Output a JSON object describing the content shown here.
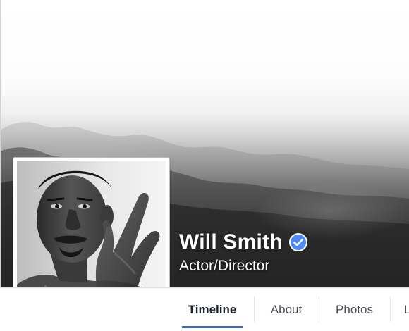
{
  "profile": {
    "name": "Will Smith",
    "subtitle": "Actor/Director",
    "verified": true
  },
  "nav": {
    "tabs": [
      {
        "label": "Timeline",
        "active": true
      },
      {
        "label": "About",
        "active": false
      },
      {
        "label": "Photos",
        "active": false
      },
      {
        "label": "L",
        "active": false
      }
    ]
  },
  "colors": {
    "verified_badge": "#4c8bf5",
    "active_tab_underline": "#4267b2",
    "tab_text": "#4b4f56",
    "name_text": "#ffffff"
  },
  "icons": {
    "verified": "verified-check-icon"
  }
}
